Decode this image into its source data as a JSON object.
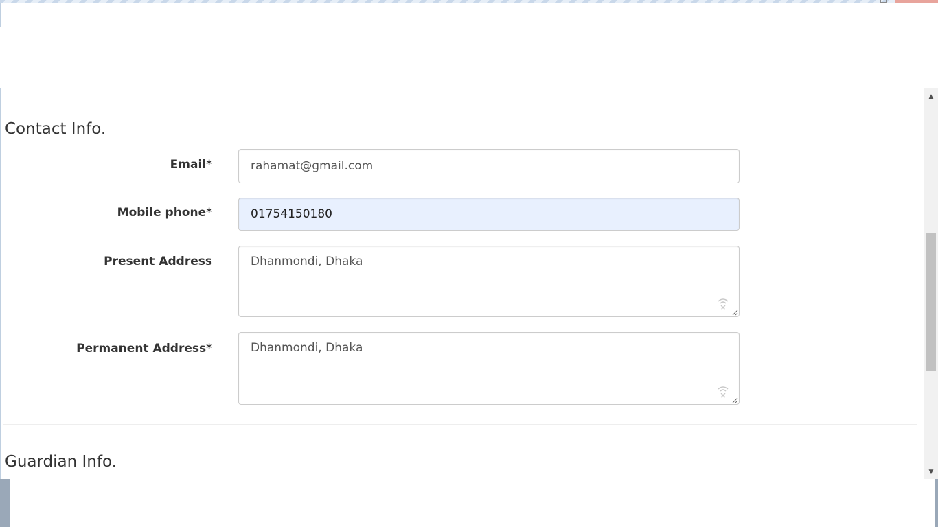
{
  "contact": {
    "title": "Contact Info.",
    "email_label": "Email*",
    "email_value": "rahamat@gmail.com",
    "mobile_label": "Mobile phone*",
    "mobile_value": "01754150180",
    "present_label": "Present Address",
    "present_value": "Dhanmondi, Dhaka",
    "permanent_label": "Permanent Address*",
    "permanent_value": "Dhanmondi, Dhaka"
  },
  "guardian": {
    "title": "Guardian Info."
  },
  "icons": {
    "textarea_extension": "wifi-x-icon",
    "resize": "resize-handle-icon",
    "scroll_up": "scroll-up-arrow-icon",
    "scroll_down": "scroll-down-arrow-icon"
  },
  "colors": {
    "autofill_bg": "#e8f0fe",
    "border": "#cccccc",
    "text": "#333333"
  }
}
